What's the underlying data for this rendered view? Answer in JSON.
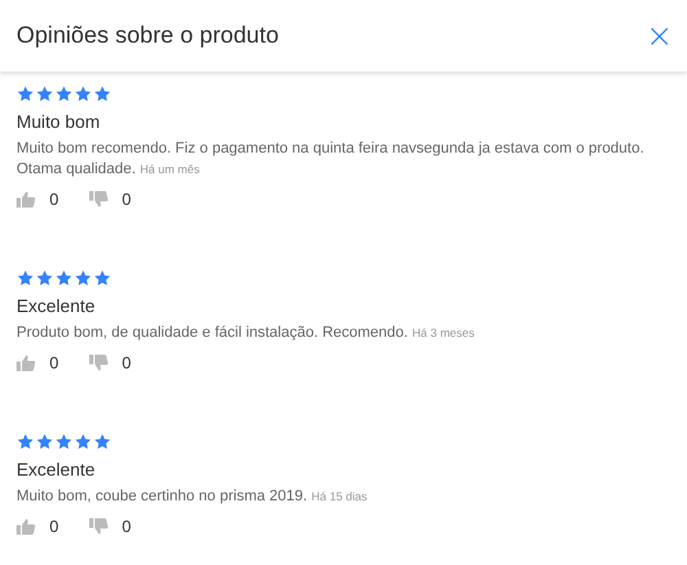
{
  "header": {
    "title": "Opiniões sobre o produto",
    "close": "×"
  },
  "reviews": [
    {
      "stars": 5,
      "title": "Muito bom",
      "body": "Muito bom recomendo. Fiz o pagamento na quinta feira navsegunda ja estava com o produto. Otama qualidade.",
      "time": "Há um mês",
      "likes": "0",
      "dislikes": "0"
    },
    {
      "stars": 5,
      "title": "Excelente",
      "body": "Produto bom, de qualidade e fácil instalação. Recomendo.",
      "time": "Há 3 meses",
      "likes": "0",
      "dislikes": "0"
    },
    {
      "stars": 5,
      "title": "Excelente",
      "body": "Muito bom, coube certinho no prisma 2019.",
      "time": "Há 15 dias",
      "likes": "0",
      "dislikes": "0"
    }
  ]
}
